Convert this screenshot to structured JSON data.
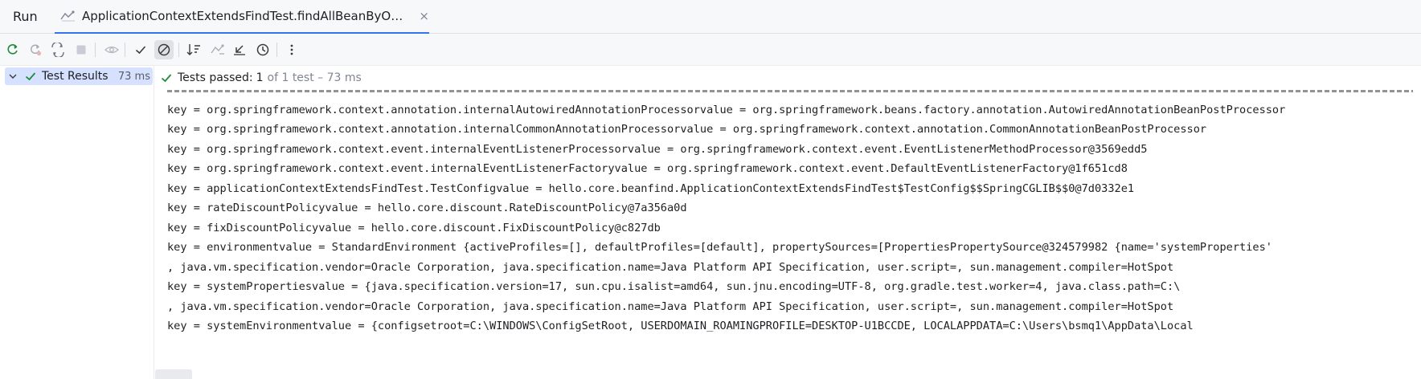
{
  "header": {
    "panel_title": "Run",
    "tab_title": "ApplicationContextExtendsFindTest.findAllBeanByObject...",
    "tab_close": "×"
  },
  "toolbar": {
    "buttons": [
      {
        "name": "rerun-icon"
      },
      {
        "name": "rerun-failed-icon"
      },
      {
        "name": "toggle-auto-test-icon"
      },
      {
        "name": "stop-icon"
      },
      {
        "name": "eye-icon"
      },
      {
        "name": "show-passed-icon"
      },
      {
        "name": "show-ignored-icon"
      },
      {
        "name": "sort-icon"
      },
      {
        "name": "import-tests-icon"
      },
      {
        "name": "export-icon"
      },
      {
        "name": "history-icon"
      },
      {
        "name": "more-icon"
      }
    ]
  },
  "tree": {
    "root_label": "Test Results",
    "root_time": "73 ms"
  },
  "status": {
    "passed_label": "Tests passed:",
    "passed_count": "1",
    "rest": "of 1 test – 73 ms"
  },
  "console": {
    "lines": [
      "key = org.springframework.context.annotation.internalAutowiredAnnotationProcessorvalue = org.springframework.beans.factory.annotation.AutowiredAnnotationBeanPostProcessor",
      "key = org.springframework.context.annotation.internalCommonAnnotationProcessorvalue = org.springframework.context.annotation.CommonAnnotationBeanPostProcessor",
      "key = org.springframework.context.event.internalEventListenerProcessorvalue = org.springframework.context.event.EventListenerMethodProcessor@3569edd5",
      "key = org.springframework.context.event.internalEventListenerFactoryvalue = org.springframework.context.event.DefaultEventListenerFactory@1f651cd8",
      "key = applicationContextExtendsFindTest.TestConfigvalue = hello.core.beanfind.ApplicationContextExtendsFindTest$TestConfig$$SpringCGLIB$$0@7d0332e1",
      "key = rateDiscountPolicyvalue = hello.core.discount.RateDiscountPolicy@7a356a0d",
      "key = fixDiscountPolicyvalue = hello.core.discount.FixDiscountPolicy@c827db",
      "key = environmentvalue = StandardEnvironment {activeProfiles=[], defaultProfiles=[default], propertySources=[PropertiesPropertySource@324579982 {name='systemProperties'",
      ", java.vm.specification.vendor=Oracle Corporation, java.specification.name=Java Platform API Specification, user.script=, sun.management.compiler=HotSpot",
      "key = systemPropertiesvalue = {java.specification.version=17, sun.cpu.isalist=amd64, sun.jnu.encoding=UTF-8, org.gradle.test.worker=4, java.class.path=C:\\",
      ", java.vm.specification.vendor=Oracle Corporation, java.specification.name=Java Platform API Specification, user.script=, sun.management.compiler=HotSpot",
      "key = systemEnvironmentvalue = {configsetroot=C:\\WINDOWS\\ConfigSetRoot, USERDOMAIN_ROAMINGPROFILE=DESKTOP-U1BCCDE, LOCALAPPDATA=C:\\Users\\bsmq1\\AppData\\Local"
    ]
  },
  "colors": {
    "accent": "#3574f0",
    "success": "#208a3c",
    "selection": "#d5e1ff"
  }
}
